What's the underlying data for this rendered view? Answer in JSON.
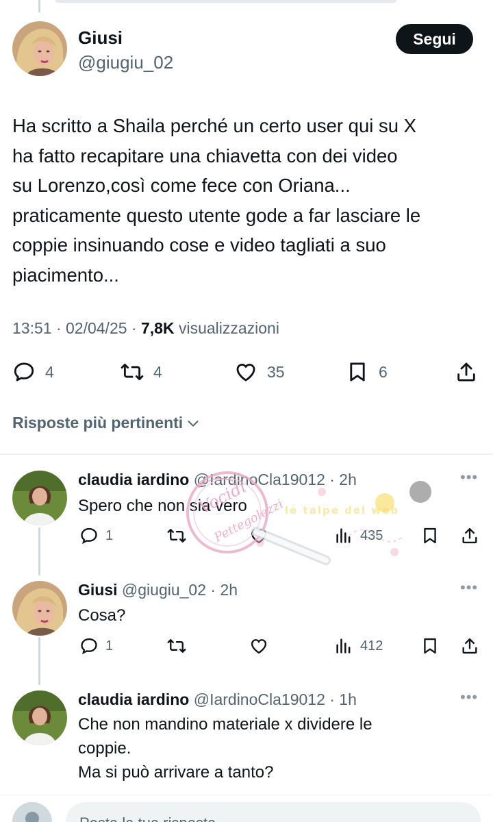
{
  "main_tweet": {
    "name": "Giusi",
    "handle": "@giugiu_02",
    "follow_label": "Segui",
    "lines": [
      "Ha scritto a Shaila perché un certo user qui su X",
      "ha fatto recapitare una chiavetta con dei video",
      "su Lorenzo,così come fece con Oriana...",
      "praticamente questo utente gode a far lasciare le",
      "coppie insinuando cose e video tagliati a suo",
      "piacimento..."
    ],
    "time": "13:51 · 02/04/25 · ",
    "views_count": "7,8K",
    "views_label": " visualizzazioni",
    "replies": "4",
    "reposts": "4",
    "likes": "35",
    "bookmarks": "6"
  },
  "section": {
    "title": "Risposte più pertinenti"
  },
  "replies": [
    {
      "name": "claudia iardino",
      "handle": " @IardinoCla19012 · 2h",
      "lines": [
        "Spero che non sia vero"
      ],
      "replies": "1",
      "views": "435"
    },
    {
      "name": "Giusi",
      "handle": " @giugiu_02 · 2h",
      "lines": [
        "Cosa?"
      ],
      "replies": "1",
      "views": "412"
    },
    {
      "name": "claudia iardino",
      "handle": " @IardinoCla19012 · 1h",
      "lines": [
        "Che non mandino materiale x dividere le",
        "coppie.",
        "Ma si può arrivare a tanto?"
      ]
    }
  ],
  "compose": {
    "placeholder": "Posta la tua risposta"
  },
  "watermark": {
    "text1": "Vocidi",
    "text2": "Pettegolezzi",
    "text3": "le talpe del web"
  },
  "icons": {
    "reply": "comment-icon",
    "repost": "repost-icon",
    "like": "heart-icon",
    "views": "analytics-icon",
    "bookmark": "bookmark-icon",
    "share": "share-icon",
    "more": "more-icon",
    "chevron": "chevron-down-icon"
  }
}
